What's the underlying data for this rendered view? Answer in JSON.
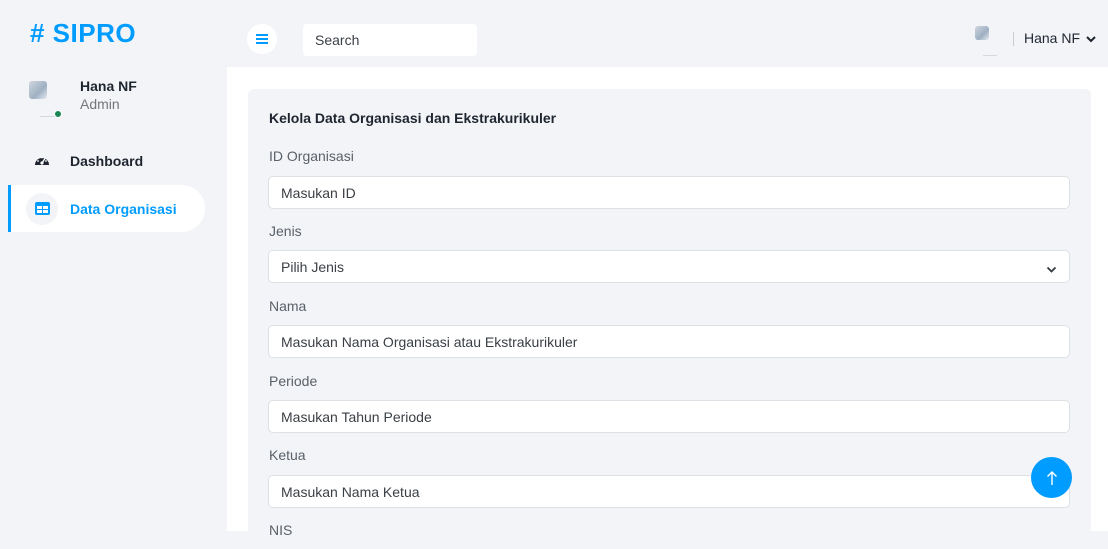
{
  "brand": {
    "title": "# SIPRO",
    "color": "#009cff"
  },
  "sidebar": {
    "user": {
      "name": "Hana NF",
      "role": "Admin",
      "status": "online"
    },
    "items": [
      {
        "label": "Dashboard",
        "icon": "dashboard-gauge-icon",
        "active": false
      },
      {
        "label": "Data Organisasi",
        "icon": "table-icon",
        "active": true
      }
    ]
  },
  "topbar": {
    "menu_icon": "hamburger-icon",
    "search": {
      "placeholder": "Search",
      "value": ""
    },
    "user": {
      "name": "Hana NF"
    }
  },
  "form": {
    "title": "Kelola Data Organisasi dan Ekstrakurikuler",
    "fields": [
      {
        "label": "ID Organisasi",
        "placeholder": "Masukan ID"
      },
      {
        "label": "Jenis",
        "placeholder": "Pilih Jenis"
      },
      {
        "label": "Nama",
        "placeholder": "Masukan Nama Organisasi atau Ekstrakurikuler"
      },
      {
        "label": "Periode",
        "placeholder": "Masukan Tahun Periode"
      },
      {
        "label": "Ketua",
        "placeholder": "Masukan Nama Ketua"
      },
      {
        "label": "NIS"
      }
    ]
  },
  "back_to_top": {
    "icon": "arrow-up-icon"
  },
  "colors": {
    "accent": "#009cff",
    "online": "#198754"
  }
}
